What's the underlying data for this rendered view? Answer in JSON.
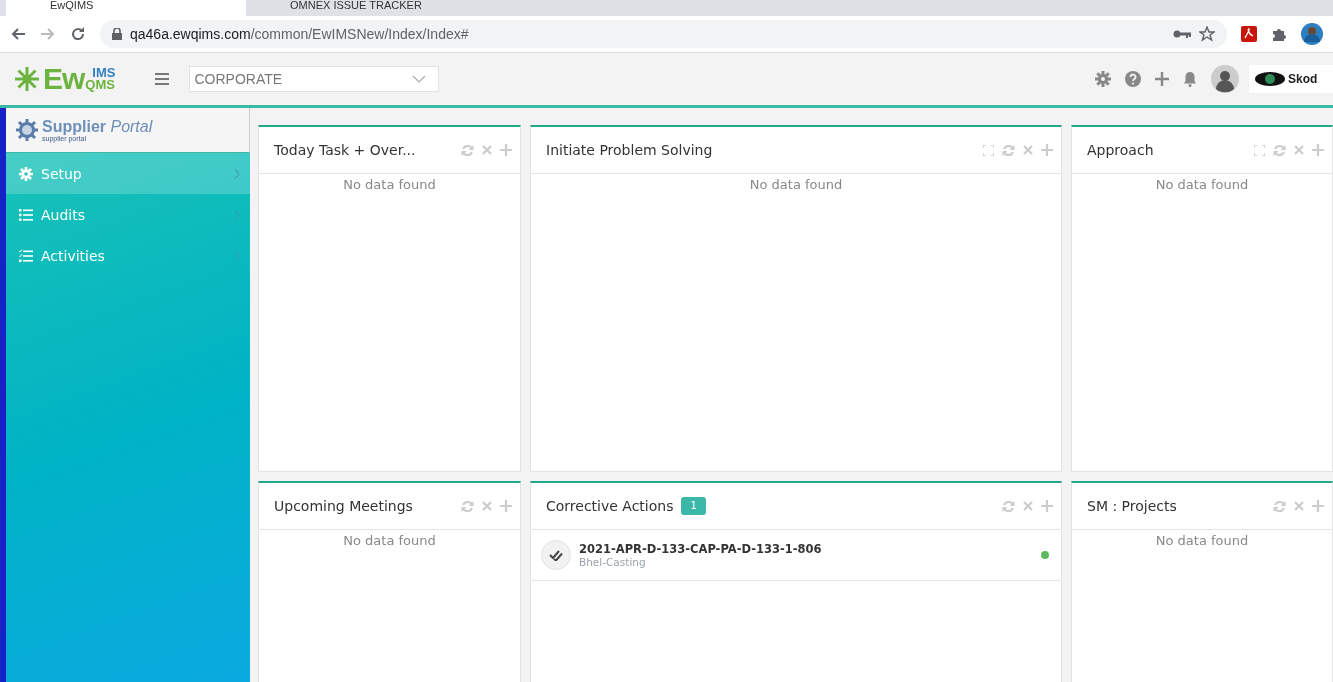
{
  "browser": {
    "tabs": [
      {
        "label": "EwQIMS",
        "selected": true
      },
      {
        "label": "OMNEX ISSUE TRACKER",
        "selected": false
      }
    ],
    "url_host": "qa46a.ewqims.com",
    "url_path": "/common/EwIMSNew/Index/Index#"
  },
  "header": {
    "logo": {
      "main": "Ew",
      "top": "IMS",
      "bottom": "QMS"
    },
    "site_select": {
      "value": "CORPORATE"
    },
    "client_logo": "Skod"
  },
  "sidebar": {
    "brand": {
      "title": "Supplier",
      "title_italic": "Portal",
      "subtitle": "supplier portal"
    },
    "items": [
      {
        "kind": "gear",
        "label": "Setup",
        "selected": true
      },
      {
        "kind": "list",
        "label": "Audits",
        "selected": false
      },
      {
        "kind": "checklist",
        "label": "Activities",
        "selected": false
      }
    ]
  },
  "panels": [
    {
      "title": "Today Task + Over...",
      "maximizable": false,
      "empty_text": "No data found"
    },
    {
      "title": "Initiate Problem Solving",
      "maximizable": true,
      "empty_text": "No data found"
    },
    {
      "title": "Approach",
      "maximizable": true,
      "empty_text": "No data found"
    },
    {
      "title": "Upcoming Meetings",
      "maximizable": false,
      "empty_text": "No data found"
    },
    {
      "title": "Corrective Actions",
      "maximizable": false,
      "count": "1",
      "items": [
        {
          "title": "2021-APR-D-133-CAP-PA-D-133-1-806",
          "subtitle": "Bhel-Casting",
          "color": "#5cb85c"
        }
      ]
    },
    {
      "title": "SM : Projects",
      "maximizable": false,
      "empty_text": "No data found"
    }
  ]
}
